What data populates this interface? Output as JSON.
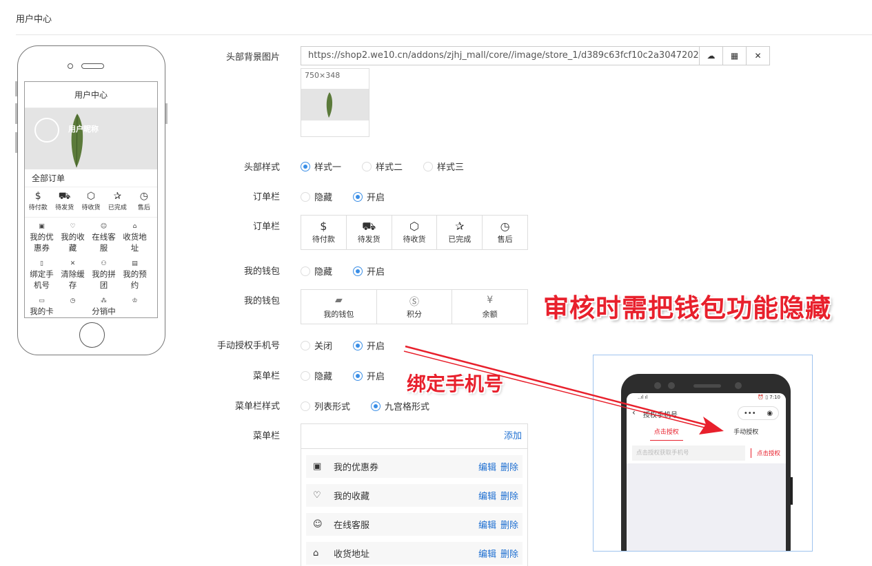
{
  "page": {
    "title": "用户中心"
  },
  "preview": {
    "title": "用户中心",
    "nickname": "用户昵称",
    "all_orders": "全部订单",
    "order_icons": [
      {
        "icon": "dollar-icon",
        "glyph": "$",
        "label": "待付款"
      },
      {
        "icon": "truck-icon",
        "glyph": "⛟",
        "label": "待发货"
      },
      {
        "icon": "box-icon",
        "glyph": "⬡",
        "label": "待收货"
      },
      {
        "icon": "pin-icon",
        "glyph": "✰",
        "label": "已完成"
      },
      {
        "icon": "history-icon",
        "glyph": "◷",
        "label": "售后"
      }
    ],
    "grid": [
      {
        "icon": "coupon-icon",
        "glyph": "▣",
        "label": "我的优惠券"
      },
      {
        "icon": "heart-icon",
        "glyph": "♡",
        "label": "我的收藏"
      },
      {
        "icon": "smile-icon",
        "glyph": "☺",
        "label": "在线客服"
      },
      {
        "icon": "home-icon",
        "glyph": "⌂",
        "label": "收货地址"
      },
      {
        "icon": "phone-icon",
        "glyph": "▯",
        "label": "绑定手机号"
      },
      {
        "icon": "close-icon",
        "glyph": "✕",
        "label": "清除缓存"
      },
      {
        "icon": "group-icon",
        "glyph": "⚇",
        "label": "我的拼团"
      },
      {
        "icon": "calendar-icon",
        "glyph": "▤",
        "label": "我的预约"
      },
      {
        "icon": "card-icon",
        "glyph": "▭",
        "label": "我的卡"
      },
      {
        "icon": "clock-icon",
        "glyph": "◷",
        "label": ""
      },
      {
        "icon": "share-icon",
        "glyph": "⁂",
        "label": "分销中"
      },
      {
        "icon": "crown-icon",
        "glyph": "♔",
        "label": ""
      }
    ]
  },
  "form": {
    "header_bg": {
      "label": "头部背景图片",
      "url": "https://shop2.we10.cn/addons/zjhj_mall/core//image/store_1/d389c63fcf10c2a3047202d99",
      "size_hint": "750×348",
      "buttons": {
        "upload": "cloud-upload-icon",
        "gallery": "grid-icon",
        "clear": "close-icon"
      }
    },
    "header_style": {
      "label": "头部样式",
      "options": [
        "样式一",
        "样式二",
        "样式三"
      ],
      "selected": 0
    },
    "order_bar_toggle": {
      "label": "订单栏",
      "options": [
        "隐藏",
        "开启"
      ],
      "selected": 1
    },
    "order_bar_icons": {
      "label": "订单栏",
      "items": [
        {
          "icon": "dollar-icon",
          "glyph": "$",
          "label": "待付款"
        },
        {
          "icon": "truck-icon",
          "glyph": "⛟",
          "label": "待发货"
        },
        {
          "icon": "box-icon",
          "glyph": "⬡",
          "label": "待收货"
        },
        {
          "icon": "pin-icon",
          "glyph": "✰",
          "label": "已完成"
        },
        {
          "icon": "history-icon",
          "glyph": "◷",
          "label": "售后"
        }
      ]
    },
    "wallet_toggle": {
      "label": "我的钱包",
      "options": [
        "隐藏",
        "开启"
      ],
      "selected": 1
    },
    "wallet_icons": {
      "label": "我的钱包",
      "items": [
        {
          "icon": "wallet-icon",
          "glyph": "▰",
          "label": "我的钱包"
        },
        {
          "icon": "dollar-circle-icon",
          "glyph": "Ⓢ",
          "label": "积分"
        },
        {
          "icon": "money-bag-icon",
          "glyph": "¥",
          "label": "余额"
        }
      ]
    },
    "manual_phone": {
      "label": "手动授权手机号",
      "options": [
        "关闭",
        "开启"
      ],
      "selected": 1
    },
    "menu_toggle": {
      "label": "菜单栏",
      "options": [
        "隐藏",
        "开启"
      ],
      "selected": 1
    },
    "menu_style": {
      "label": "菜单栏样式",
      "options": [
        "列表形式",
        "九宫格形式"
      ],
      "selected": 1
    },
    "menu_list": {
      "label": "菜单栏",
      "add": "添加",
      "edit": "编辑",
      "delete": "删除",
      "items": [
        {
          "icon": "coupon-icon",
          "glyph": "▣",
          "label": "我的优惠券"
        },
        {
          "icon": "heart-icon",
          "glyph": "♡",
          "label": "我的收藏"
        },
        {
          "icon": "smile-icon",
          "glyph": "☺",
          "label": "在线客服"
        },
        {
          "icon": "home-icon",
          "glyph": "⌂",
          "label": "收货地址"
        }
      ]
    }
  },
  "annotations": {
    "notice": "审核时需把钱包功能隐藏",
    "bind_phone": "绑定手机号"
  },
  "inset": {
    "status_left": "..ıl ıl",
    "status_right": "⏰ ▯ 7:10",
    "nav_title": "授权手机号",
    "capsule_dots": "•••",
    "tabs": [
      "点击授权",
      "手动授权"
    ],
    "active_tab": 0,
    "input_placeholder": "点击授权获取手机号",
    "authorize_btn": "点击授权"
  },
  "colors": {
    "accent": "#3a8ee6",
    "link": "#1e6fd1",
    "annotation_red": "#e8202c"
  }
}
